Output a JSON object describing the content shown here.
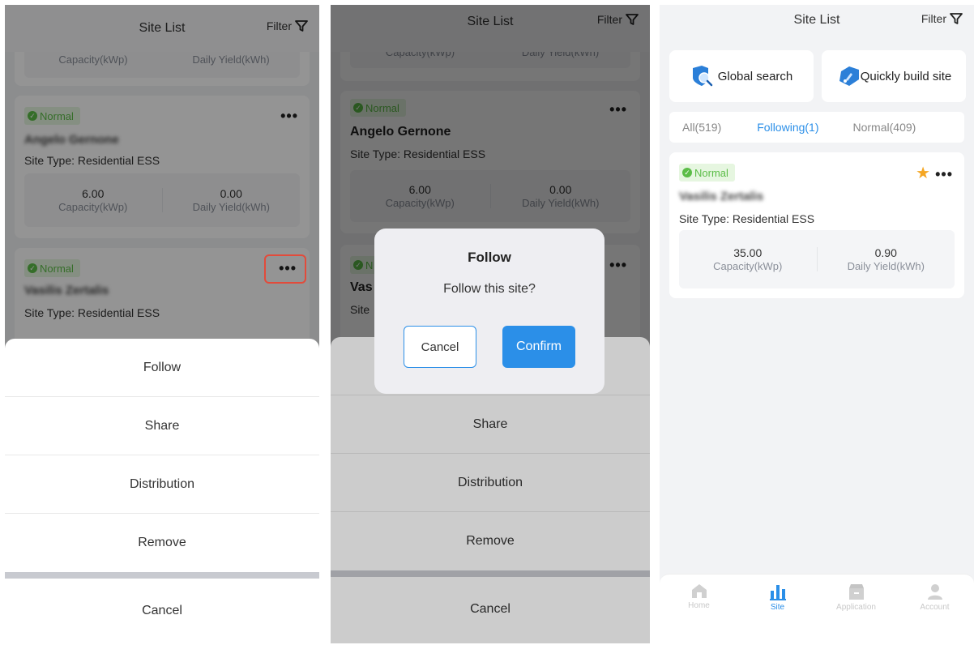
{
  "nav": {
    "title": "Site List",
    "filter_label": "Filter"
  },
  "panel1": {
    "top_card": {
      "capacity_label": "Capacity(kWp)",
      "yield_label": "Daily Yield(kWh)"
    },
    "card_a": {
      "status": "Normal",
      "name": "Angelo Gernone",
      "site_type": "Site Type: Residential ESS",
      "capacity": "6.00",
      "capacity_label": "Capacity(kWp)",
      "yield": "0.00",
      "yield_label": "Daily Yield(kWh)"
    },
    "card_b": {
      "status": "Normal",
      "name": "Vasilis Zertalis",
      "site_type": "Site Type: Residential ESS"
    },
    "sheet": {
      "follow": "Follow",
      "share": "Share",
      "distribution": "Distribution",
      "remove": "Remove",
      "cancel": "Cancel"
    }
  },
  "panel2": {
    "top_card": {
      "capacity_label": "Capacity(kWp)",
      "yield_label": "Daily Yield(kWh)"
    },
    "card_a": {
      "status": "Normal",
      "name": "Angelo Gernone",
      "site_type": "Site Type: Residential ESS",
      "capacity": "6.00",
      "capacity_label": "Capacity(kWp)",
      "yield": "0.00",
      "yield_label": "Daily Yield(kWh)"
    },
    "card_b": {
      "status": "N",
      "name": "Vas",
      "site_type": "Site"
    },
    "sheet": {
      "share": "Share",
      "distribution": "Distribution",
      "remove": "Remove",
      "cancel": "Cancel"
    },
    "dialog": {
      "title": "Follow",
      "message": "Follow this site?",
      "cancel": "Cancel",
      "confirm": "Confirm"
    }
  },
  "panel3": {
    "global_search": "Global search",
    "quick_build": "Quickly build site",
    "tabs": {
      "all": "All(519)",
      "following": "Following(1)",
      "normal": "Normal(409)"
    },
    "card": {
      "status": "Normal",
      "name": "Vasilis Zertalis",
      "site_type": "Site Type: Residential ESS",
      "capacity": "35.00",
      "capacity_label": "Capacity(kWp)",
      "yield": "0.90",
      "yield_label": "Daily Yield(kWh)"
    },
    "tabbar": {
      "home": "Home",
      "site": "Site",
      "application": "Application",
      "account": "Account"
    }
  },
  "colors": {
    "accent": "#2b8fe8",
    "normal_green": "#5cbd48",
    "star": "#f5a623",
    "highlight": "#e24b3b"
  }
}
